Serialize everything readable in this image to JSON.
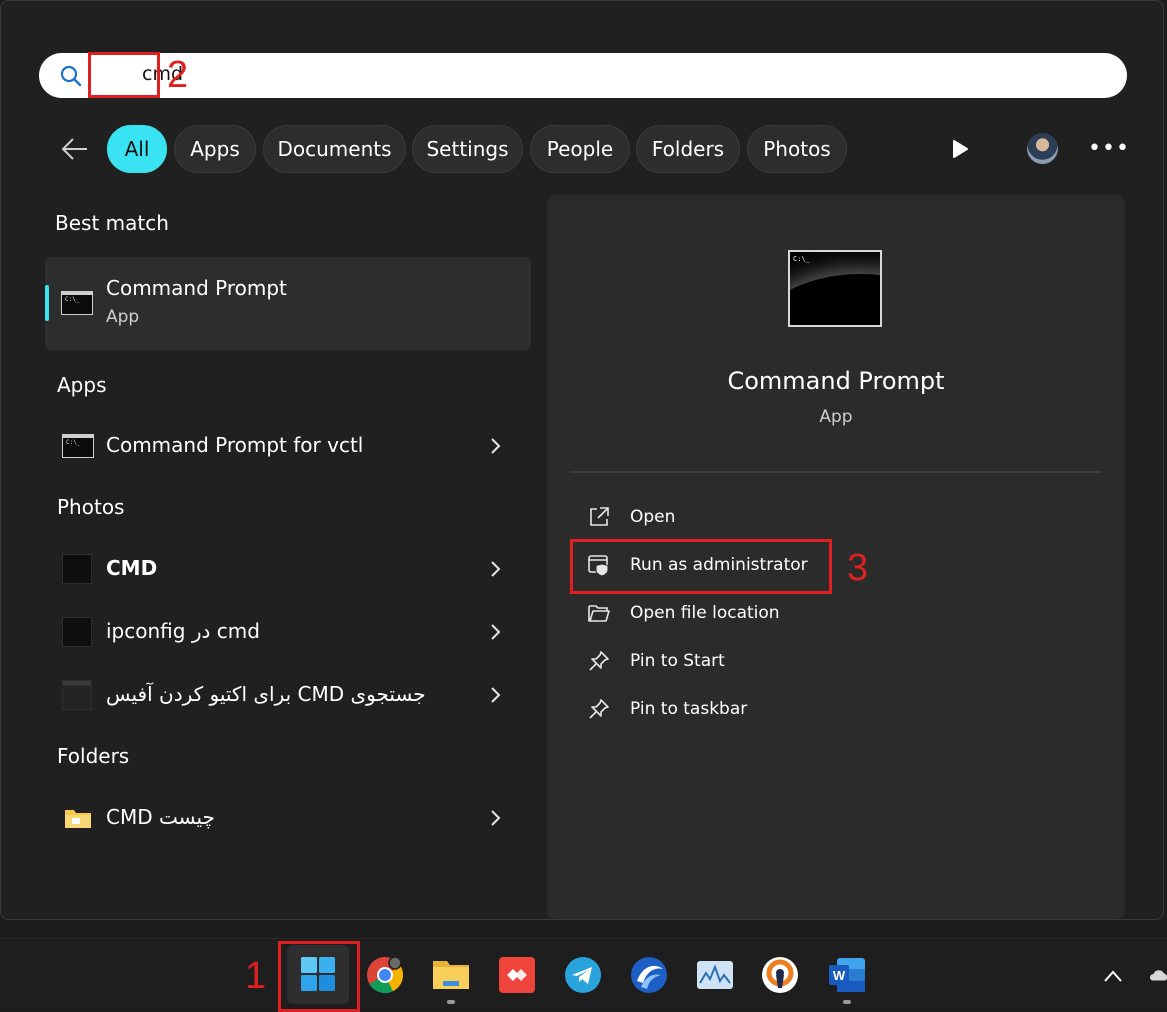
{
  "search": {
    "query": "cmd"
  },
  "filters": [
    "All",
    "Apps",
    "Documents",
    "Settings",
    "People",
    "Folders",
    "Photos"
  ],
  "sections": {
    "best_match": "Best match",
    "apps": "Apps",
    "photos": "Photos",
    "folders": "Folders"
  },
  "best_match": {
    "title": "Command Prompt",
    "subtitle": "App"
  },
  "apps": [
    {
      "title": "Command Prompt for vctl"
    }
  ],
  "photos": [
    {
      "title": "CMD"
    },
    {
      "title": "ipconfig در cmd"
    },
    {
      "title": "برای اکتیو کردن آفیس CMD جستجوی"
    }
  ],
  "folders": [
    {
      "title": "CMD چیست"
    }
  ],
  "preview": {
    "title": "Command Prompt",
    "subtitle": "App",
    "prompt_text": "C:\\_",
    "actions": [
      "Open",
      "Run as administrator",
      "Open file location",
      "Pin to Start",
      "Pin to taskbar"
    ]
  },
  "annotations": {
    "a1": "1",
    "a2": "2",
    "a3": "3"
  },
  "colors": {
    "accent": "#3ae3f2",
    "annotation": "#e02020",
    "panel": "#202020",
    "preview": "#2b2b2b"
  },
  "taskbar": {
    "icons": [
      "start-icon",
      "chrome-icon",
      "file-explorer-icon",
      "anydesk-icon",
      "telegram-icon",
      "browser-icon",
      "monitor-app-icon",
      "openvpn-icon",
      "word-icon",
      "chevron-up-icon",
      "onedrive-icon"
    ]
  }
}
